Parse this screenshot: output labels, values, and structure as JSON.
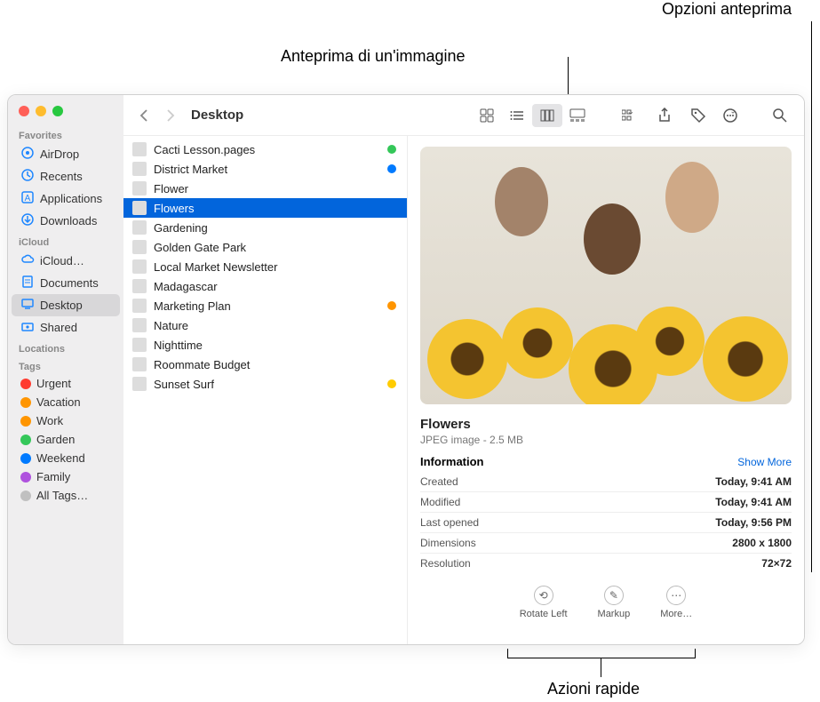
{
  "annotations": {
    "preview_image": "Anteprima di un'immagine",
    "preview_options": "Opzioni anteprima",
    "quick_actions": "Azioni rapide"
  },
  "window": {
    "title": "Desktop"
  },
  "sidebar": {
    "favorites_label": "Favorites",
    "favorites": [
      {
        "icon": "airdrop",
        "label": "AirDrop"
      },
      {
        "icon": "recents",
        "label": "Recents"
      },
      {
        "icon": "apps",
        "label": "Applications"
      },
      {
        "icon": "downloads",
        "label": "Downloads"
      }
    ],
    "icloud_label": "iCloud",
    "icloud": [
      {
        "icon": "cloud",
        "label": "iCloud…"
      },
      {
        "icon": "doc",
        "label": "Documents"
      },
      {
        "icon": "desktop",
        "label": "Desktop",
        "selected": true
      },
      {
        "icon": "shared",
        "label": "Shared"
      }
    ],
    "locations_label": "Locations",
    "tags_label": "Tags",
    "tags": [
      {
        "color": "#ff3b30",
        "label": "Urgent"
      },
      {
        "color": "#ff9500",
        "label": "Vacation"
      },
      {
        "color": "#ff9500",
        "label": "Work"
      },
      {
        "color": "#34c759",
        "label": "Garden"
      },
      {
        "color": "#007aff",
        "label": "Weekend"
      },
      {
        "color": "#af52de",
        "label": "Family"
      },
      {
        "color": "#c0c0c0",
        "label": "All Tags…"
      }
    ]
  },
  "files": [
    {
      "name": "Cacti Lesson.pages",
      "tag": "#34c759"
    },
    {
      "name": "District Market",
      "tag": "#007aff"
    },
    {
      "name": "Flower"
    },
    {
      "name": "Flowers",
      "selected": true
    },
    {
      "name": "Gardening"
    },
    {
      "name": "Golden Gate Park"
    },
    {
      "name": "Local Market Newsletter"
    },
    {
      "name": "Madagascar"
    },
    {
      "name": "Marketing Plan",
      "tag": "#ff9500"
    },
    {
      "name": "Nature"
    },
    {
      "name": "Nighttime"
    },
    {
      "name": "Roommate Budget"
    },
    {
      "name": "Sunset Surf",
      "tag": "#ffcc00"
    }
  ],
  "preview": {
    "title": "Flowers",
    "subtitle": "JPEG image - 2.5 MB",
    "info_header": "Information",
    "show_more": "Show More",
    "rows": [
      {
        "k": "Created",
        "v": "Today, 9:41 AM"
      },
      {
        "k": "Modified",
        "v": "Today, 9:41 AM"
      },
      {
        "k": "Last opened",
        "v": "Today, 9:56 PM"
      },
      {
        "k": "Dimensions",
        "v": "2800 x 1800"
      },
      {
        "k": "Resolution",
        "v": "72×72"
      }
    ],
    "actions": [
      {
        "id": "rotate",
        "label": "Rotate Left",
        "glyph": "⟲"
      },
      {
        "id": "markup",
        "label": "Markup",
        "glyph": "✎"
      },
      {
        "id": "more",
        "label": "More…",
        "glyph": "⋯"
      }
    ]
  }
}
